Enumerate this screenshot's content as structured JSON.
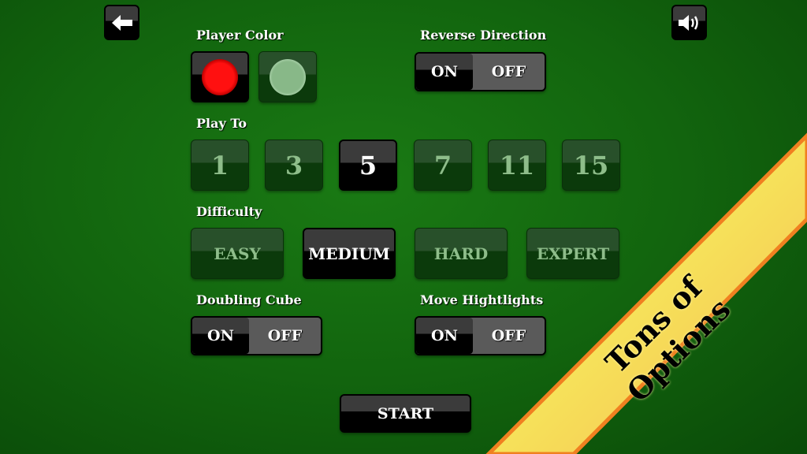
{
  "header": {
    "back_icon": "arrow-left-icon",
    "sound_icon": "speaker-volume-icon"
  },
  "player_color": {
    "label": "Player Color",
    "options": [
      {
        "color": "#ff0000",
        "selected": true
      },
      {
        "color": "#86b886",
        "selected": false
      }
    ]
  },
  "reverse_direction": {
    "label": "Reverse Direction",
    "on": "ON",
    "off": "OFF",
    "value": "ON"
  },
  "play_to": {
    "label": "Play To",
    "options": [
      "1",
      "3",
      "5",
      "7",
      "11",
      "15"
    ],
    "selected": "5"
  },
  "difficulty": {
    "label": "Difficulty",
    "options": [
      "EASY",
      "MEDIUM",
      "HARD",
      "EXPERT"
    ],
    "selected": "MEDIUM"
  },
  "doubling_cube": {
    "label": "Doubling Cube",
    "on": "ON",
    "off": "OFF",
    "value": "ON"
  },
  "move_highlights": {
    "label": "Move Hightlights",
    "on": "ON",
    "off": "OFF",
    "value": "ON"
  },
  "start_label": "START",
  "banner": {
    "text": "Tons of Options",
    "color": "#f8b850",
    "edge_color": "#f08020"
  }
}
